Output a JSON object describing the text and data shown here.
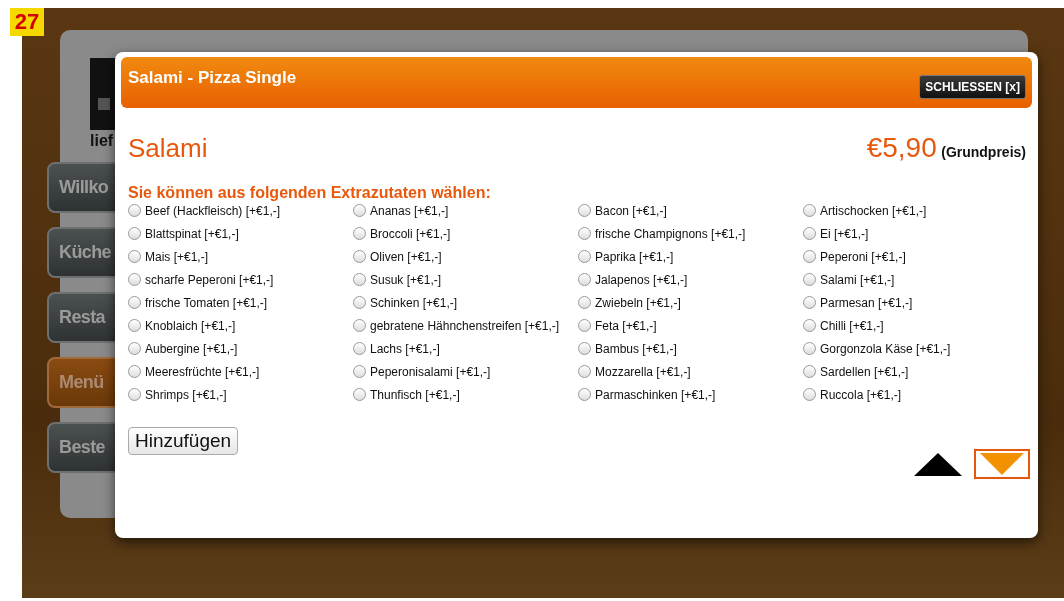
{
  "figure_number": "27",
  "site": {
    "logo_text": "lief",
    "nav": [
      {
        "label": "Willko",
        "selected": false
      },
      {
        "label": "Küche",
        "selected": false
      },
      {
        "label": "Resta",
        "selected": false
      },
      {
        "label": "Menü",
        "selected": true
      },
      {
        "label": "Beste",
        "selected": false
      }
    ]
  },
  "dialog": {
    "title": "Salami - Pizza Single",
    "close_button": "SCHLIESSEN [x]",
    "product": "Salami",
    "price": "€5,90",
    "price_note": "(Grundpreis)",
    "extras_heading": "Sie können aus folgenden Extrazutaten wählen:",
    "extras": [
      {
        "label": "Beef (Hackfleisch) [+€1,-]",
        "checked": false
      },
      {
        "label": "Ananas [+€1,-]",
        "checked": false
      },
      {
        "label": "Bacon [+€1,-]",
        "checked": false
      },
      {
        "label": "Artischocken [+€1,-]",
        "checked": false
      },
      {
        "label": "Blattspinat [+€1,-]",
        "checked": false
      },
      {
        "label": "Broccoli [+€1,-]",
        "checked": false
      },
      {
        "label": "frische Champignons [+€1,-]",
        "checked": false
      },
      {
        "label": "Ei [+€1,-]",
        "checked": false
      },
      {
        "label": "Mais [+€1,-]",
        "checked": false
      },
      {
        "label": "Oliven [+€1,-]",
        "checked": false
      },
      {
        "label": "Paprika [+€1,-]",
        "checked": false
      },
      {
        "label": "Peperoni [+€1,-]",
        "checked": false
      },
      {
        "label": "scharfe Peperoni [+€1,-]",
        "checked": false
      },
      {
        "label": "Susuk [+€1,-]",
        "checked": false
      },
      {
        "label": "Jalapenos [+€1,-]",
        "checked": false
      },
      {
        "label": "Salami [+€1,-]",
        "checked": false
      },
      {
        "label": "frische Tomaten [+€1,-]",
        "checked": false
      },
      {
        "label": "Schinken [+€1,-]",
        "checked": false
      },
      {
        "label": "Zwiebeln [+€1,-]",
        "checked": false
      },
      {
        "label": "Parmesan [+€1,-]",
        "checked": false
      },
      {
        "label": "Knoblaich [+€1,-]",
        "checked": false
      },
      {
        "label": "gebratene Hähnchenstreifen [+€1,-]",
        "checked": false
      },
      {
        "label": "Feta [+€1,-]",
        "checked": false
      },
      {
        "label": "Chilli [+€1,-]",
        "checked": false
      },
      {
        "label": "Aubergine [+€1,-]",
        "checked": false
      },
      {
        "label": "Lachs [+€1,-]",
        "checked": false
      },
      {
        "label": "Bambus [+€1,-]",
        "checked": false
      },
      {
        "label": "Gorgonzola Käse [+€1,-]",
        "checked": false
      },
      {
        "label": "Meeresfrüchte [+€1,-]",
        "checked": false
      },
      {
        "label": "Peperonisalami [+€1,-]",
        "checked": false
      },
      {
        "label": "Mozzarella [+€1,-]",
        "checked": false
      },
      {
        "label": "Sardellen [+€1,-]",
        "checked": false
      },
      {
        "label": "Shrimps [+€1,-]",
        "checked": false
      },
      {
        "label": "Thunfisch [+€1,-]",
        "checked": false
      },
      {
        "label": "Parmaschinken [+€1,-]",
        "checked": false
      },
      {
        "label": "Ruccola [+€1,-]",
        "checked": false
      }
    ],
    "add_button": "Hinzufügen",
    "pager": [
      {
        "kind": "up",
        "selected": false
      },
      {
        "kind": "down",
        "selected": true
      }
    ]
  }
}
